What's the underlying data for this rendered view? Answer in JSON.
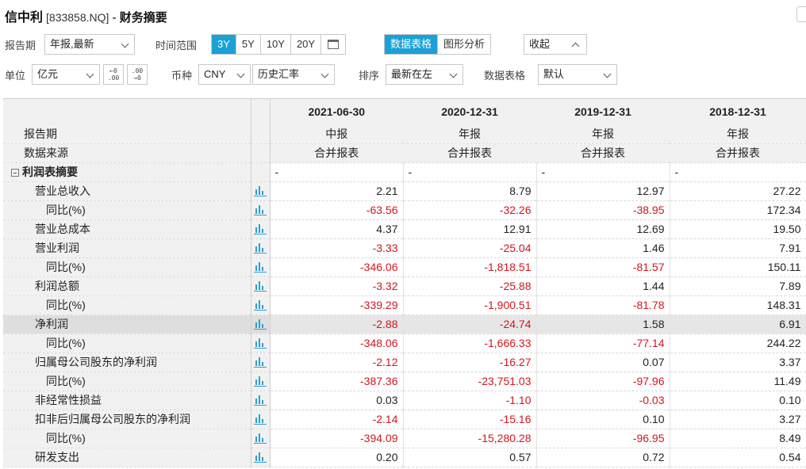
{
  "title": {
    "company": "信中利",
    "code": "[833858.NQ]",
    "separator": "-",
    "subtitle": "财务摘要"
  },
  "toolbar1": {
    "report_period_label": "报告期",
    "report_period_value": "年报,最新",
    "time_range_label": "时间范围",
    "time_ranges": [
      "3Y",
      "5Y",
      "10Y",
      "20Y"
    ],
    "active_time_range": "3Y",
    "view_modes": [
      "数据表格",
      "图形分析"
    ],
    "active_view_mode": "数据表格",
    "collapse_label": "收起"
  },
  "toolbar2": {
    "unit_label": "单位",
    "unit_value": "亿元",
    "decimal_increase": "←0\n.00",
    "decimal_decrease": ".00\n→0",
    "currency_label": "币种",
    "currency_value": "CNY",
    "rate_value": "历史汇率",
    "sort_label": "排序",
    "sort_value": "最新在左",
    "table_format_label": "数据表格",
    "table_format_value": "默认"
  },
  "table": {
    "columns": [
      "2021-06-30",
      "2020-12-31",
      "2019-12-31",
      "2018-12-31"
    ],
    "meta_rows": [
      {
        "label": "报告期",
        "values": [
          "中报",
          "年报",
          "年报",
          "年报"
        ]
      },
      {
        "label": "数据来源",
        "values": [
          "合并报表",
          "合并报表",
          "合并报表",
          "合并报表"
        ]
      }
    ],
    "section": {
      "label": "利润表摘要",
      "values": [
        "-",
        "-",
        "-",
        "-"
      ]
    },
    "rows": [
      {
        "label": "营业总收入",
        "indent": false,
        "values": [
          "2.21",
          "8.79",
          "12.97",
          "27.22"
        ]
      },
      {
        "label": "同比(%)",
        "indent": true,
        "values": [
          "-63.56",
          "-32.26",
          "-38.95",
          "172.34"
        ]
      },
      {
        "label": "营业总成本",
        "indent": false,
        "values": [
          "4.37",
          "12.91",
          "12.69",
          "19.50"
        ]
      },
      {
        "label": "营业利润",
        "indent": false,
        "values": [
          "-3.33",
          "-25.04",
          "1.46",
          "7.91"
        ]
      },
      {
        "label": "同比(%)",
        "indent": true,
        "values": [
          "-346.06",
          "-1,818.51",
          "-81.57",
          "150.11"
        ]
      },
      {
        "label": "利润总额",
        "indent": false,
        "values": [
          "-3.32",
          "-25.88",
          "1.44",
          "7.89"
        ]
      },
      {
        "label": "同比(%)",
        "indent": true,
        "values": [
          "-339.29",
          "-1,900.51",
          "-81.78",
          "148.31"
        ]
      },
      {
        "label": "净利润",
        "indent": false,
        "highlight": true,
        "values": [
          "-2.88",
          "-24.74",
          "1.58",
          "6.91"
        ]
      },
      {
        "label": "同比(%)",
        "indent": true,
        "values": [
          "-348.06",
          "-1,666.33",
          "-77.14",
          "244.22"
        ]
      },
      {
        "label": "归属母公司股东的净利润",
        "indent": false,
        "values": [
          "-2.12",
          "-16.27",
          "0.07",
          "3.37"
        ]
      },
      {
        "label": "同比(%)",
        "indent": true,
        "values": [
          "-387.36",
          "-23,751.03",
          "-97.96",
          "11.49"
        ]
      },
      {
        "label": "非经常性损益",
        "indent": false,
        "values": [
          "0.03",
          "-1.10",
          "-0.03",
          "0.10"
        ]
      },
      {
        "label": "扣非后归属母公司股东的净利润",
        "indent": false,
        "values": [
          "-2.14",
          "-15.16",
          "0.10",
          "3.27"
        ]
      },
      {
        "label": "同比(%)",
        "indent": true,
        "values": [
          "-394.09",
          "-15,280.28",
          "-96.95",
          "8.49"
        ]
      },
      {
        "label": "研发支出",
        "indent": false,
        "values": [
          "0.20",
          "0.57",
          "0.72",
          "0.54"
        ]
      }
    ]
  },
  "colors": {
    "accent": "#1ba1d6",
    "negative": "#d2161f",
    "header_bg": "#f1f1f1",
    "chart_icon": "#2f9fd4"
  },
  "icons": {
    "row_chart": "bar-chart-icon",
    "collapse_section": "minus-box-icon",
    "calendar": "calendar-icon"
  }
}
